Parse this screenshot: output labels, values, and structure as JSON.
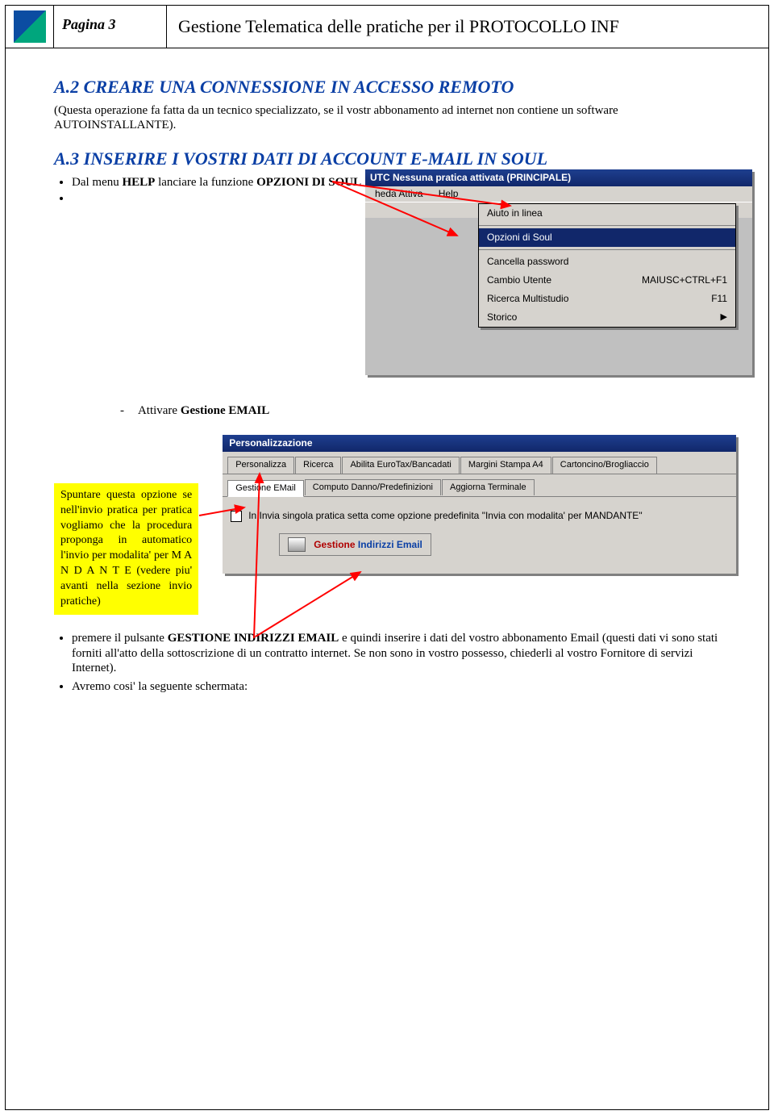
{
  "header": {
    "page_label": "Pagina 3",
    "doc_title": "Gestione Telematica delle pratiche per il PROTOCOLLO INF"
  },
  "section_a2": {
    "heading": "A.2 CREARE UNA CONNESSIONE IN ACCESSO REMOTO",
    "note": "(Questa operazione fa fatta da un tecnico specializzato, se il vostr abbonamento ad internet non contiene un software AUTOINSTALLANTE)."
  },
  "section_a3": {
    "heading": "A.3 INSERIRE I VOSTRI DATI DI ACCOUNT E-MAIL IN SOUL",
    "step1_prefix": "Dal menu ",
    "step1_b1": "HELP",
    "step1_mid": " lanciare la funzione ",
    "step1_b2": "OPZIONI DI SOUL",
    "step2_prefix": "Attivare ",
    "step2_b": "Gestione EMAIL"
  },
  "callout": "Spuntare questa opzione se nell'invio pratica per pratica vogliamo che la procedura proponga in automatico l'invio per modalita' per M A N D A N T E (vedere piu' avanti nella sezione invio pratiche)",
  "screenshot1": {
    "title": "UTC   Nessuna pratica attivata (PRINCIPALE)",
    "menu_item_1": "heda Attiva",
    "menu_item_2": "Help",
    "dd_aiuto": "Aiuto in linea",
    "dd_opzioni": "Opzioni di Soul",
    "dd_cancella": "Cancella password",
    "dd_cambio": "Cambio Utente",
    "dd_cambio_sc": "MAIUSC+CTRL+F1",
    "dd_ricerca": "Ricerca Multistudio",
    "dd_ricerca_sc": "F11",
    "dd_storico": "Storico"
  },
  "screenshot2": {
    "title": "Personalizzazione",
    "tabs_row1": [
      "Personalizza",
      "Ricerca",
      "Abilita EuroTax/Bancadati",
      "Margini Stampa A4",
      "Cartoncino/Brogliaccio"
    ],
    "tabs_row2": [
      "Gestione EMail",
      "Computo Danno/Predefinizioni",
      "Aggiorna Terminale"
    ],
    "chk_label": "In Invia singola pratica setta come opzione predefinita \"Invia con modalita' per MANDANTE\"",
    "button_p1": "Gestione ",
    "button_p2": "Indirizzi Email"
  },
  "bottom": {
    "bul1_prefix": "premere il pulsante ",
    "bul1_b": "GESTIONE INDIRIZZI EMAIL",
    "bul1_rest": " e quindi inserire i dati del vostro abbonamento Email (questi dati vi sono stati forniti all'atto della sottoscrizione di un contratto internet. Se non sono in vostro possesso, chiederli al vostro Fornitore di servizi Internet).",
    "bul2": "Avremo cosi' la seguente schermata:"
  }
}
